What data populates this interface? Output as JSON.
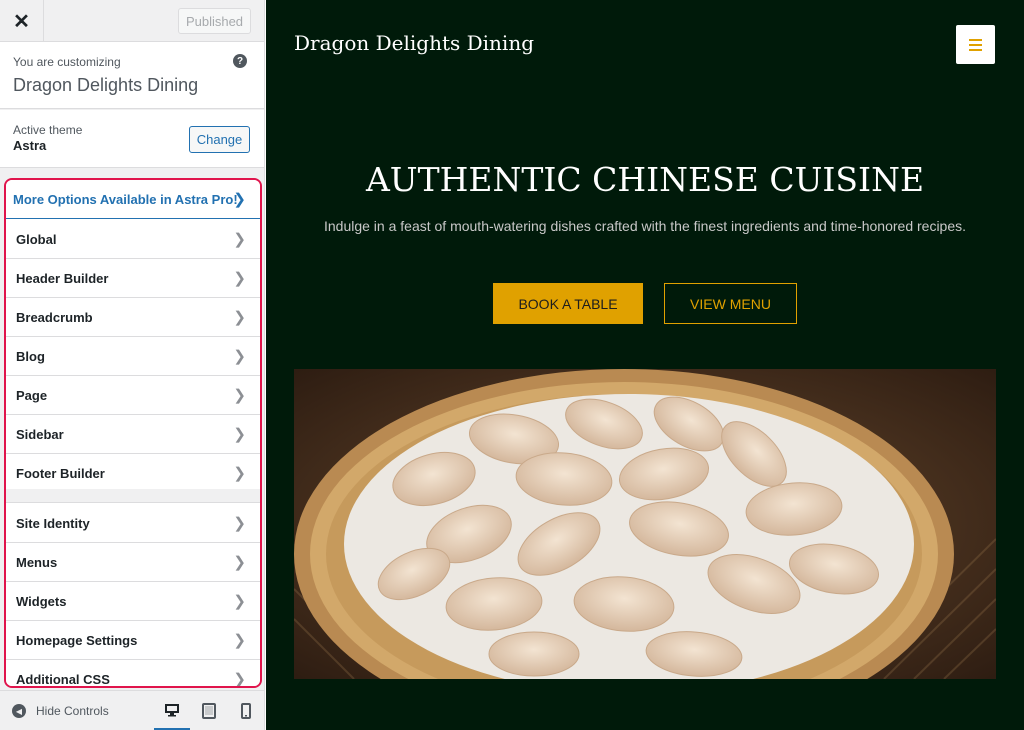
{
  "topbar": {
    "close_icon": "close-icon",
    "published_label": "Published"
  },
  "info": {
    "customizing_label": "You are customizing",
    "site_name": "Dragon Delights Dining",
    "help_icon": "help-icon"
  },
  "theme": {
    "active_label": "Active theme",
    "theme_name": "Astra",
    "change_label": "Change"
  },
  "menu": {
    "pro": {
      "label": "More Options Available in Astra Pro!"
    },
    "items": [
      {
        "label": "Global"
      },
      {
        "label": "Header Builder"
      },
      {
        "label": "Breadcrumb"
      },
      {
        "label": "Blog"
      },
      {
        "label": "Page"
      },
      {
        "label": "Sidebar"
      },
      {
        "label": "Footer Builder"
      },
      {
        "label": "Site Identity"
      },
      {
        "label": "Menus"
      },
      {
        "label": "Widgets"
      },
      {
        "label": "Homepage Settings"
      },
      {
        "label": "Additional CSS"
      }
    ],
    "chevron_icon": "chevron-right-icon",
    "highlight_color": "#e0144c"
  },
  "bottom": {
    "hide_label": "Hide Controls",
    "devices": [
      "desktop-icon",
      "tablet-icon",
      "mobile-icon"
    ],
    "active_device": "desktop"
  },
  "preview": {
    "brand": "Dragon Delights Dining",
    "hero_title": "AUTHENTIC CHINESE CUISINE",
    "hero_subtitle": "Indulge in a feast of mouth-watering dishes crafted with the finest ingredients and time-honored recipes.",
    "book_label": "BOOK A TABLE",
    "menu_label": "VIEW MENU",
    "background_color": "#001a0a",
    "accent_color": "#e0a100",
    "hero_image": "dumplings-on-bamboo-tray"
  }
}
